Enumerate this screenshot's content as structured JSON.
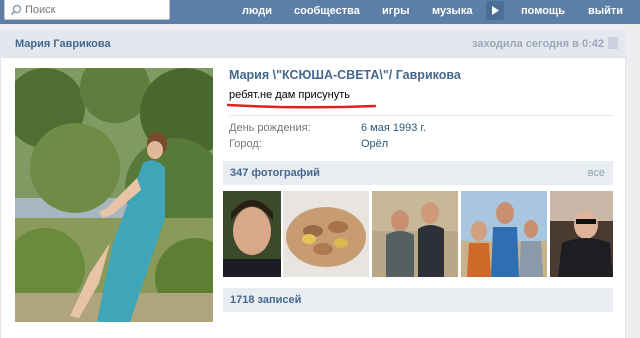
{
  "topbar": {
    "search_placeholder": "Поиск",
    "nav": [
      "люди",
      "сообщества",
      "игры",
      "музыка",
      "помощь",
      "выйти"
    ]
  },
  "header": {
    "name": "Мария Гаврикова",
    "status_prefix": "заходила сегодня в",
    "status_time": "0:42"
  },
  "profile": {
    "full_name": "Мария \\\"КСЮША-СВЕТА\\\"/ Гаврикова",
    "status": "ребят.не дам присунуть",
    "fields": [
      {
        "label": "День рождения:",
        "value": "6 мая 1993 г."
      },
      {
        "label": "Город:",
        "value": "Орёл"
      }
    ]
  },
  "photos": {
    "title": "347 фотографий",
    "all_label": "все"
  },
  "posts": {
    "title": "1718 записей"
  }
}
